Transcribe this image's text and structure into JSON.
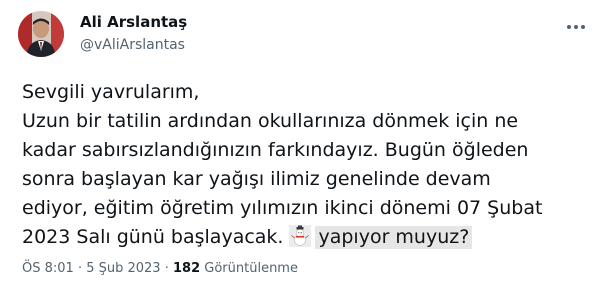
{
  "author": {
    "display_name": "Ali Arslantaş",
    "handle": "@vAliArslantas"
  },
  "icons": {
    "avatar": "profile-photo",
    "more": "more-options-icon",
    "emoji": "snowman-emoji"
  },
  "tweet": {
    "lines": [
      "Sevgili yavrularım,",
      "Uzun bir tatilin ardından okullarınıza dönmek için ne",
      "kadar sabırsızlandığınızın farkındayız. Bugün öğleden",
      "sonra başlayan kar yağışı ilimiz genelinde devam",
      "ediyor, eğitim öğretim yılımızın ikinci dönemi 07 Şubat",
      "2023 Salı günü başlayacak."
    ],
    "highlighted_text": "yapıyor muyuz?"
  },
  "meta": {
    "time": "ÖS 8:01",
    "separator1": " · ",
    "date": "5 Şub 2023",
    "separator2": " · ",
    "views_count": "182",
    "views_label": " Görüntülenme"
  }
}
